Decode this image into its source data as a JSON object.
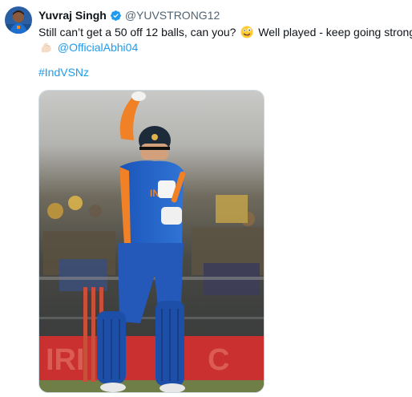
{
  "tweet": {
    "author_name": "Yuvraj Singh",
    "author_handle": "@YUVSTRONG12",
    "text_line1": "Still can’t get a 50 off 12 balls, can you?",
    "text_line1_tail": "Well played - keep going strong!",
    "mention": "@OfficialAbhi04",
    "hashtag": "#IndVSNz",
    "emoji_1": "zany-face-emoji",
    "emoji_2": "flexed-biceps-emoji",
    "verified_icon": "verified-badge-icon",
    "colors": {
      "link": "#1d9bf0",
      "text": "#0f1419",
      "secondary": "#536471",
      "verified": "#1d9bf0"
    }
  }
}
